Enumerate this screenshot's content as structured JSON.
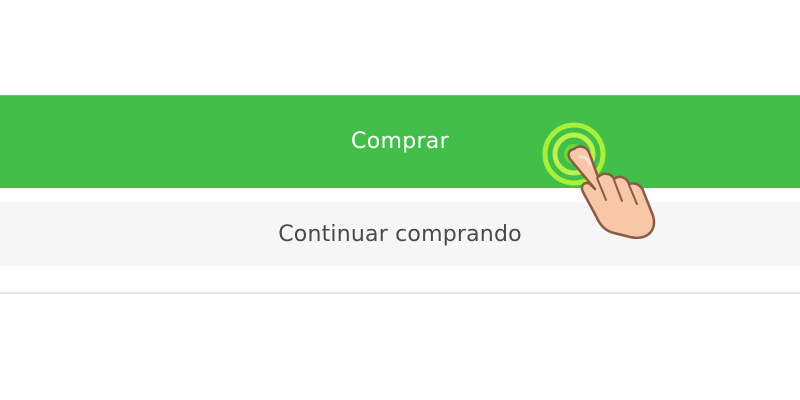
{
  "actions": {
    "buy_label": "Comprar",
    "continue_label": "Continuar comprando"
  },
  "colors": {
    "primary": "#42bf49",
    "secondary_bg": "#f6f6f6",
    "secondary_text": "#4a4a4a",
    "tap_ring": "#b7f33a"
  },
  "icons": {
    "tap": "tap-ring-icon",
    "hand": "pointing-hand-icon"
  }
}
